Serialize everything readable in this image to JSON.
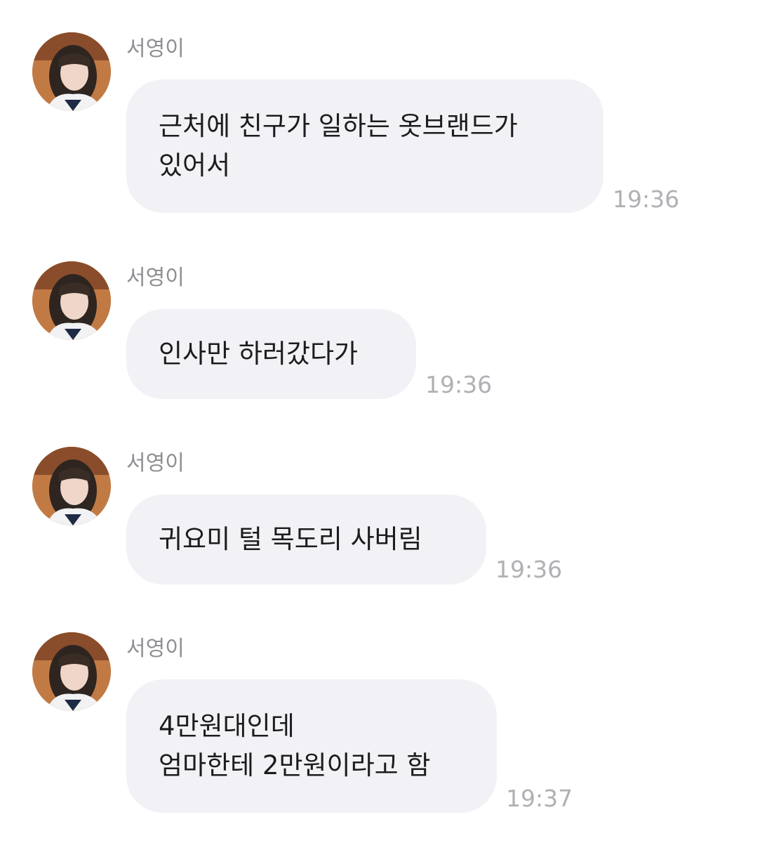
{
  "messages": [
    {
      "sender": "서영이",
      "text": "근처에 친구가 일하는 옷브랜드가\n있어서",
      "time": "19:36"
    },
    {
      "sender": "서영이",
      "text": "인사만 하러갔다가",
      "time": "19:36"
    },
    {
      "sender": "서영이",
      "text": "귀요미 털 목도리 사버림",
      "time": "19:36"
    },
    {
      "sender": "서영이",
      "text": "4만원대인데\n엄마한테 2만원이라고 함",
      "time": "19:37"
    }
  ],
  "colors": {
    "bubble": "#f2f2f6",
    "text": "#1c1c1e",
    "sender": "#8e8e93",
    "time": "#b0b0b5"
  }
}
